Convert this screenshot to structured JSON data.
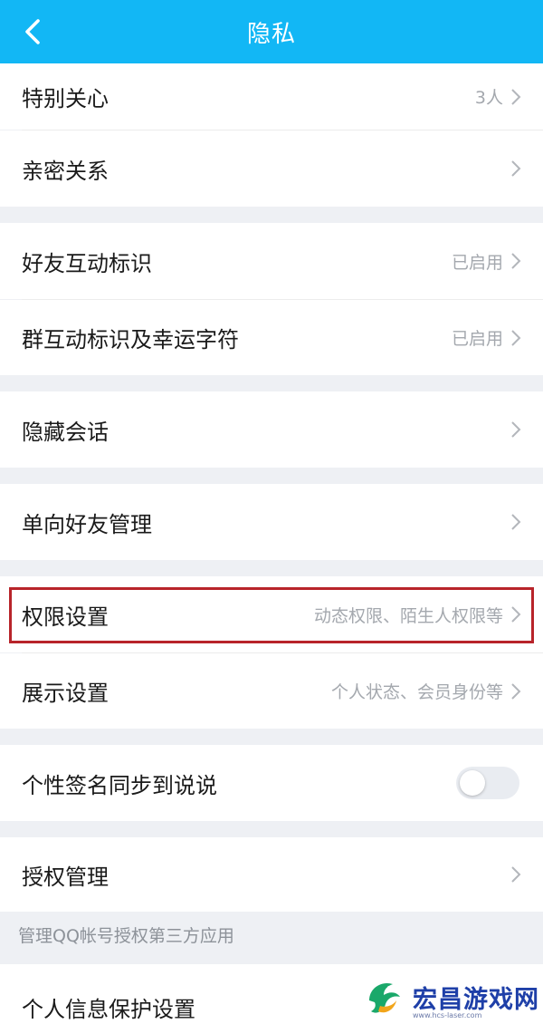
{
  "header": {
    "title": "隐私"
  },
  "rows": {
    "special_care": {
      "label": "特别关心",
      "value": "3人"
    },
    "intimate": {
      "label": "亲密关系"
    },
    "friend_badge": {
      "label": "好友互动标识",
      "value": "已启用"
    },
    "group_badge": {
      "label": "群互动标识及幸运字符",
      "value": "已启用"
    },
    "hidden_chat": {
      "label": "隐藏会话"
    },
    "one_way": {
      "label": "单向好友管理"
    },
    "permission": {
      "label": "权限设置",
      "value": "动态权限、陌生人权限等"
    },
    "display": {
      "label": "展示设置",
      "value": "个人状态、会员身份等"
    },
    "signature_sync": {
      "label": "个性签名同步到说说",
      "toggle_on": false
    },
    "auth": {
      "label": "授权管理"
    },
    "personal_info": {
      "label": "个人信息保护设置"
    }
  },
  "auth_note": "管理QQ帐号授权第三方应用",
  "watermark": {
    "text": "宏昌游戏网",
    "url": "www.hcs-laser.com"
  },
  "colors": {
    "header": "#12b7f5",
    "highlight_border": "#b8242a",
    "page_bg": "#eef0f4"
  }
}
